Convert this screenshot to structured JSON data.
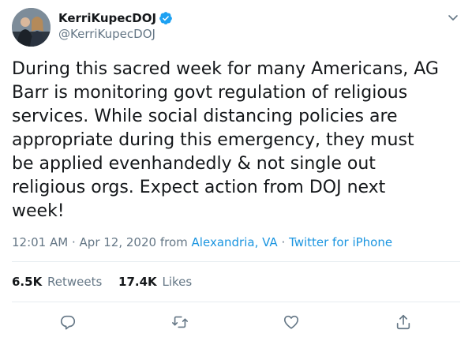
{
  "author": {
    "display_name": "KerriKupecDOJ",
    "handle": "@KerriKupecDOJ",
    "verified": true
  },
  "tweet": {
    "text": "During this sacred week for many Americans, AG\nBarr is monitoring govt regulation of religious\nservices. While social distancing policies are\nappropriate during this emergency, they must\nbe applied evenhandedly & not single out\nreligious orgs. Expect action from DOJ next\nweek!"
  },
  "meta": {
    "time": "12:01 AM",
    "separator": "·",
    "date": "Apr 12, 2020",
    "from_label": "from",
    "location": "Alexandria, VA",
    "source": "Twitter for iPhone"
  },
  "stats": {
    "retweets_count": "6.5K",
    "retweets_label": "Retweets",
    "likes_count": "17.4K",
    "likes_label": "Likes"
  },
  "icons": {
    "verified": "verified-badge-icon",
    "more": "chevron-down-icon",
    "reply": "reply-icon",
    "retweet": "retweet-icon",
    "like": "heart-icon",
    "share": "share-icon"
  },
  "colors": {
    "text": "#14171a",
    "secondary": "#657786",
    "link": "#1b95e0",
    "verified": "#1da1f2",
    "divider": "#e6ecf0"
  }
}
